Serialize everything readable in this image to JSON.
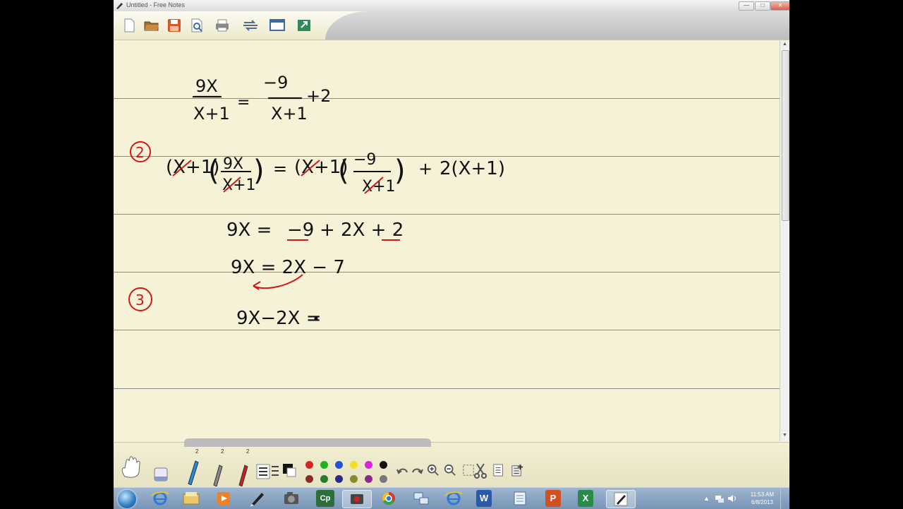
{
  "window": {
    "title": "Untitled - Free Notes",
    "minimize": "—",
    "maximize": "□",
    "close": "✕"
  },
  "toolbar": {
    "buttons": [
      {
        "name": "new-page-icon",
        "color": "#ffffff"
      },
      {
        "name": "open-folder-icon",
        "color": "#8a5a2b"
      },
      {
        "name": "save-icon",
        "color": "#d9552a"
      },
      {
        "name": "print-preview-icon",
        "color": "#6b8bb0"
      },
      {
        "name": "print-icon",
        "color": "#7a7a7a"
      },
      {
        "name": "transfer-icon",
        "color": "#4a6f9c"
      },
      {
        "name": "screen-capture-icon",
        "color": "#3a6aa8"
      },
      {
        "name": "export-icon",
        "color": "#2f8a5a"
      }
    ]
  },
  "ink": {
    "line1": "9X/(X+1) = -9/(X+1) + 2",
    "step2_marker": "2",
    "line2": "(X+1)(9X/(X+1)) = (X+1)(-9/(X+1)) + 2(X+1)",
    "line3": "9X = -9 + 2X + 2",
    "line4": "9X = 2X - 7",
    "step3_marker": "3",
    "line5": "9X - 2X = ."
  },
  "pen_tool_counts": [
    "2",
    "2",
    "2"
  ],
  "palette": {
    "row1": [
      "#e02020",
      "#20b020",
      "#2050e0",
      "#f0e020",
      "#e020e0",
      "#111111"
    ],
    "row2": [
      "#8a2a2a",
      "#2a7a2a",
      "#2a2a8a",
      "#8a8a2a",
      "#8a2a8a",
      "#777777"
    ]
  },
  "taskbar": {
    "apps": [
      "internet-explorer-icon",
      "file-explorer-icon",
      "media-player-icon",
      "free-notes-icon",
      "camera-app-icon",
      "captivate-icon",
      "recorder-icon",
      "chrome-icon",
      "network-icon",
      "ie-icon",
      "word-icon",
      "notepad-icon",
      "powerpoint-icon",
      "excel-icon",
      "free-notes-icon-2"
    ],
    "captivate_label": "Cp",
    "word_label": "W",
    "powerpoint_label": "P",
    "excel_label": "X",
    "time": "11:53 AM",
    "date": "6/8/2013"
  }
}
